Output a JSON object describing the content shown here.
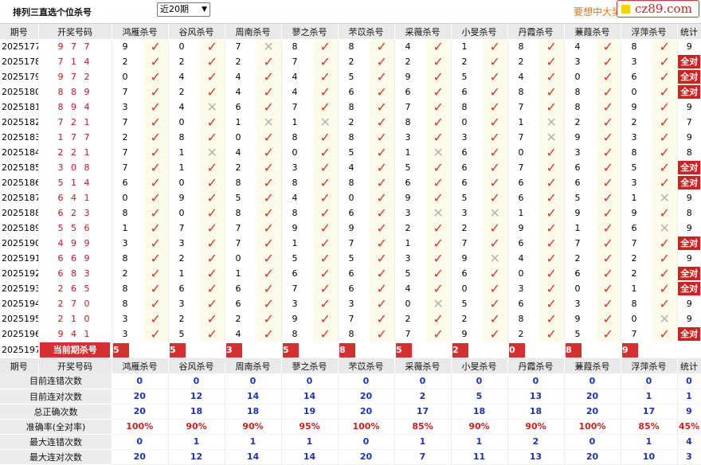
{
  "header": {
    "title": "排列三直选个位杀号",
    "period_selected": "近20期",
    "promo": "要想中大奖",
    "logo": "cz89.com"
  },
  "columns": [
    "期号",
    "开奖号码",
    "鸿雁杀号",
    "谷风杀号",
    "周南杀号",
    "蓼之杀号",
    "芣苡杀号",
    "采薇杀号",
    "小旻杀号",
    "丹霞杀号",
    "蒹葭杀号",
    "浮萍杀号",
    "统计"
  ],
  "full_label": "全对",
  "rows": [
    {
      "issue": "2025177",
      "num": "977",
      "k": [
        9,
        0,
        7,
        8,
        8,
        4,
        1,
        8,
        4,
        8
      ],
      "h": [
        1,
        1,
        0,
        1,
        1,
        1,
        1,
        1,
        1,
        1
      ],
      "st": "9"
    },
    {
      "issue": "2025178",
      "num": "714",
      "k": [
        2,
        2,
        2,
        7,
        2,
        2,
        2,
        2,
        3,
        3
      ],
      "h": [
        1,
        1,
        1,
        1,
        1,
        1,
        1,
        1,
        1,
        1
      ],
      "st": "全对"
    },
    {
      "issue": "2025179",
      "num": "972",
      "k": [
        0,
        4,
        4,
        4,
        5,
        9,
        5,
        4,
        0,
        6
      ],
      "h": [
        1,
        1,
        1,
        1,
        1,
        1,
        1,
        1,
        1,
        1
      ],
      "st": "全对"
    },
    {
      "issue": "2025180",
      "num": "889",
      "k": [
        7,
        2,
        4,
        4,
        6,
        6,
        6,
        8,
        8,
        0
      ],
      "h": [
        1,
        1,
        1,
        1,
        1,
        1,
        1,
        1,
        1,
        1
      ],
      "st": "全对"
    },
    {
      "issue": "2025181",
      "num": "894",
      "k": [
        3,
        4,
        6,
        7,
        8,
        7,
        8,
        7,
        8,
        9
      ],
      "h": [
        1,
        0,
        1,
        1,
        1,
        1,
        1,
        1,
        1,
        1
      ],
      "st": "9"
    },
    {
      "issue": "2025182",
      "num": "721",
      "k": [
        7,
        0,
        1,
        1,
        2,
        8,
        0,
        1,
        2,
        2
      ],
      "h": [
        1,
        1,
        0,
        0,
        1,
        1,
        1,
        0,
        1,
        1
      ],
      "st": "7"
    },
    {
      "issue": "2025183",
      "num": "177",
      "k": [
        2,
        8,
        0,
        8,
        8,
        3,
        3,
        7,
        9,
        3
      ],
      "h": [
        1,
        1,
        1,
        1,
        1,
        1,
        1,
        0,
        1,
        1
      ],
      "st": "9"
    },
    {
      "issue": "2025184",
      "num": "221",
      "k": [
        7,
        1,
        4,
        0,
        5,
        1,
        6,
        0,
        3,
        8
      ],
      "h": [
        1,
        0,
        1,
        1,
        1,
        0,
        1,
        1,
        1,
        1
      ],
      "st": "8"
    },
    {
      "issue": "2025185",
      "num": "308",
      "k": [
        7,
        1,
        2,
        3,
        4,
        5,
        6,
        7,
        6,
        5
      ],
      "h": [
        1,
        1,
        1,
        1,
        1,
        1,
        1,
        1,
        1,
        1
      ],
      "st": "全对"
    },
    {
      "issue": "2025186",
      "num": "514",
      "k": [
        6,
        0,
        8,
        8,
        8,
        6,
        6,
        6,
        6,
        3
      ],
      "h": [
        1,
        1,
        1,
        1,
        1,
        1,
        1,
        1,
        1,
        1
      ],
      "st": "全对"
    },
    {
      "issue": "2025187",
      "num": "641",
      "k": [
        0,
        9,
        5,
        4,
        0,
        9,
        5,
        6,
        5,
        1
      ],
      "h": [
        1,
        1,
        1,
        1,
        1,
        1,
        1,
        1,
        1,
        0
      ],
      "st": "9"
    },
    {
      "issue": "2025188",
      "num": "623",
      "k": [
        8,
        0,
        8,
        8,
        6,
        3,
        3,
        1,
        9,
        9
      ],
      "h": [
        1,
        1,
        1,
        1,
        1,
        0,
        0,
        1,
        1,
        1
      ],
      "st": "8"
    },
    {
      "issue": "2025189",
      "num": "556",
      "k": [
        1,
        7,
        7,
        9,
        9,
        2,
        2,
        9,
        1,
        6
      ],
      "h": [
        1,
        1,
        1,
        1,
        1,
        1,
        1,
        1,
        1,
        0
      ],
      "st": "9"
    },
    {
      "issue": "2025190",
      "num": "499",
      "k": [
        3,
        3,
        7,
        1,
        7,
        1,
        7,
        6,
        7,
        7
      ],
      "h": [
        1,
        1,
        1,
        1,
        1,
        1,
        1,
        1,
        1,
        1
      ],
      "st": "全对"
    },
    {
      "issue": "2025191",
      "num": "669",
      "k": [
        8,
        2,
        0,
        5,
        5,
        3,
        9,
        4,
        2,
        2
      ],
      "h": [
        1,
        1,
        1,
        1,
        1,
        1,
        0,
        1,
        1,
        1
      ],
      "st": "9"
    },
    {
      "issue": "2025192",
      "num": "683",
      "k": [
        2,
        1,
        1,
        6,
        6,
        5,
        6,
        0,
        6,
        2
      ],
      "h": [
        1,
        1,
        1,
        1,
        1,
        1,
        1,
        1,
        1,
        1
      ],
      "st": "全对"
    },
    {
      "issue": "2025193",
      "num": "265",
      "k": [
        8,
        6,
        6,
        7,
        6,
        4,
        0,
        3,
        0,
        1
      ],
      "h": [
        1,
        1,
        1,
        1,
        1,
        1,
        1,
        1,
        1,
        1
      ],
      "st": "全对"
    },
    {
      "issue": "2025194",
      "num": "270",
      "k": [
        8,
        3,
        6,
        3,
        3,
        0,
        5,
        6,
        3,
        8
      ],
      "h": [
        1,
        1,
        1,
        1,
        1,
        0,
        1,
        1,
        1,
        1
      ],
      "st": "9"
    },
    {
      "issue": "2025195",
      "num": "210",
      "k": [
        3,
        2,
        2,
        9,
        7,
        2,
        2,
        8,
        9,
        0
      ],
      "h": [
        1,
        1,
        1,
        1,
        1,
        1,
        1,
        1,
        1,
        0
      ],
      "st": "9"
    },
    {
      "issue": "2025196",
      "num": "941",
      "k": [
        3,
        5,
        4,
        8,
        8,
        7,
        9,
        2,
        5,
        7
      ],
      "h": [
        1,
        1,
        1,
        1,
        1,
        1,
        1,
        1,
        1,
        1
      ],
      "st": "全对"
    }
  ],
  "current": {
    "issue": "2025197",
    "label": "当前期杀号",
    "k": [
      "5",
      "5",
      "3",
      "5",
      "8",
      "5",
      "2",
      "0",
      "8",
      "9"
    ]
  },
  "stats": [
    {
      "label": "目前连错次数",
      "v": [
        "0",
        "0",
        "0",
        "0",
        "0",
        "0",
        "0",
        "0",
        "0",
        "0",
        "0"
      ]
    },
    {
      "label": "目前连对次数",
      "v": [
        "20",
        "12",
        "14",
        "14",
        "20",
        "2",
        "5",
        "13",
        "20",
        "1",
        "1"
      ]
    },
    {
      "label": "总正确次数",
      "v": [
        "20",
        "18",
        "18",
        "19",
        "20",
        "17",
        "18",
        "18",
        "20",
        "17",
        "9"
      ]
    },
    {
      "label": "准确率(全对率)",
      "v": [
        "100%",
        "90%",
        "90%",
        "95%",
        "100%",
        "85%",
        "90%",
        "90%",
        "100%",
        "85%",
        "45%"
      ],
      "rate": true
    },
    {
      "label": "最大连错次数",
      "v": [
        "0",
        "1",
        "1",
        "1",
        "0",
        "1",
        "1",
        "2",
        "0",
        "1",
        "4"
      ]
    },
    {
      "label": "最大连对次数",
      "v": [
        "20",
        "12",
        "14",
        "14",
        "20",
        "7",
        "11",
        "13",
        "20",
        "10",
        "3"
      ]
    }
  ]
}
